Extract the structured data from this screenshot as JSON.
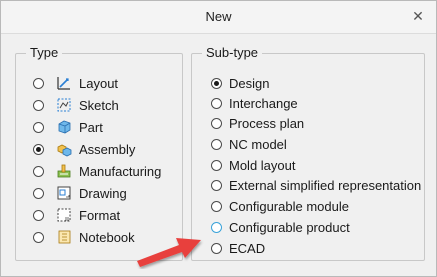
{
  "dialog": {
    "title": "New",
    "close_icon": "close-icon"
  },
  "type_group": {
    "legend": "Type",
    "selected": "Assembly",
    "items": [
      {
        "label": "Layout",
        "icon": "layout-icon",
        "checked": false
      },
      {
        "label": "Sketch",
        "icon": "sketch-icon",
        "checked": false
      },
      {
        "label": "Part",
        "icon": "part-icon",
        "checked": false
      },
      {
        "label": "Assembly",
        "icon": "assembly-icon",
        "checked": true
      },
      {
        "label": "Manufacturing",
        "icon": "manufacturing-icon",
        "checked": false
      },
      {
        "label": "Drawing",
        "icon": "drawing-icon",
        "checked": false
      },
      {
        "label": "Format",
        "icon": "format-icon",
        "checked": false
      },
      {
        "label": "Notebook",
        "icon": "notebook-icon",
        "checked": false
      }
    ]
  },
  "subtype_group": {
    "legend": "Sub-type",
    "selected": "Design",
    "items": [
      {
        "label": "Design",
        "checked": true
      },
      {
        "label": "Interchange",
        "checked": false
      },
      {
        "label": "Process plan",
        "checked": false
      },
      {
        "label": "NC model",
        "checked": false
      },
      {
        "label": "Mold layout",
        "checked": false
      },
      {
        "label": "External simplified representation",
        "checked": false
      },
      {
        "label": "Configurable module",
        "checked": false
      },
      {
        "label": "Configurable product",
        "checked": false,
        "hover": true
      },
      {
        "label": "ECAD",
        "checked": false
      }
    ]
  },
  "annotation": {
    "icon": "red-arrow-icon",
    "color": "#e8413e"
  }
}
